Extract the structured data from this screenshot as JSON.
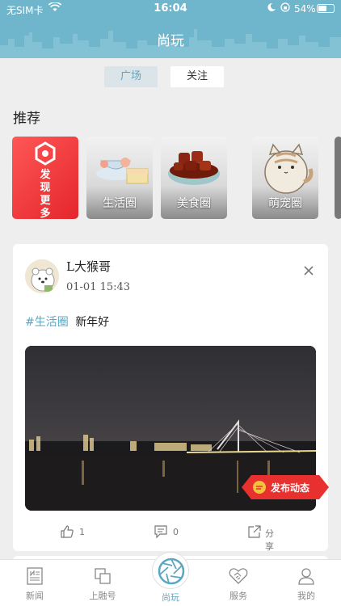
{
  "status_bar": {
    "carrier": "无SIM卡",
    "time": "16:04",
    "battery": "54%"
  },
  "header": {
    "title": "尚玩"
  },
  "tabs": [
    {
      "label": "广场",
      "active": true
    },
    {
      "label": "关注",
      "active": false
    }
  ],
  "recommend": {
    "title": "推荐",
    "discover_label": "发现更多",
    "circles": [
      {
        "label": "生活圈"
      },
      {
        "label": "美食圈"
      },
      {
        "label": "萌宠圈"
      }
    ]
  },
  "post": {
    "username": "L大猴哥",
    "time": "01-01  15:43",
    "tag": "#生活圈",
    "text": "新年好",
    "likes": "1",
    "comments": "0",
    "share_label": "分享"
  },
  "publish": {
    "label": "发布动态"
  },
  "tabbar": {
    "items": [
      {
        "label": "新闻"
      },
      {
        "label": "上融号"
      },
      {
        "label": "尚玩"
      },
      {
        "label": "服务"
      },
      {
        "label": "我的"
      }
    ]
  },
  "colors": {
    "header": "#6fb6cc",
    "accent": "#5aa7c4",
    "discover_red": "#e4262b"
  }
}
